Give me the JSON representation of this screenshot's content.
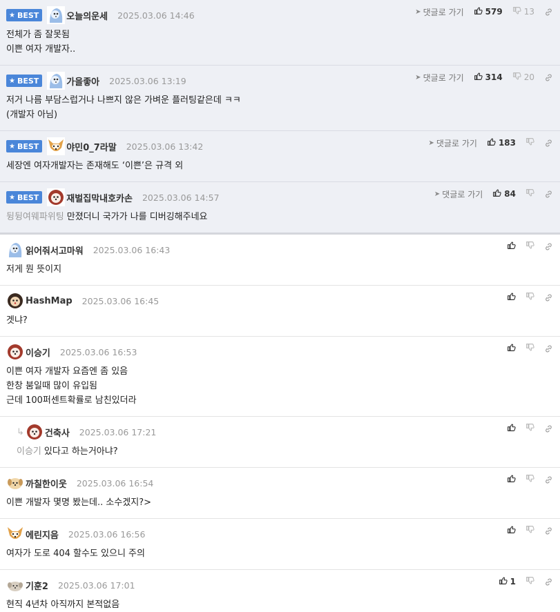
{
  "labels": {
    "best": "BEST",
    "reply_link": "댓글로 가기"
  },
  "colors": {
    "best_badge": "#4a86d9",
    "best_bg": "#eef0f5"
  },
  "comments": [
    {
      "best": true,
      "avatar": "blue",
      "nick": "오늘의운세",
      "time": "2025.03.06 14:46",
      "mention": "",
      "lines": [
        "전체가 좀 잘못됨",
        "이쁜 여자 개발자.."
      ],
      "likes": "579",
      "dislikes": "13"
    },
    {
      "best": true,
      "avatar": "blue",
      "nick": "가을좋아",
      "time": "2025.03.06 13:19",
      "mention": "",
      "lines": [
        "저거 나름 부담스럽거나 나쁘지 않은 가벼운 플러팅같은데 ㅋㅋ",
        "(개발자 아님)"
      ],
      "likes": "314",
      "dislikes": "20"
    },
    {
      "best": true,
      "avatar": "fox",
      "nick": "야민0_7라말",
      "time": "2025.03.06 13:42",
      "mention": "",
      "lines": [
        "세장엔 여자개발자는 존재해도 ‘이쁜’은 규격 외"
      ],
      "likes": "183",
      "dislikes": ""
    },
    {
      "best": true,
      "avatar": "dog-red",
      "nick": "재벌집막내호카손",
      "time": "2025.03.06 14:57",
      "mention": "뒹뒹여웨파위팅",
      "lines": [
        "만졌더니 국가가 나를 디버깅해주네요"
      ],
      "likes": "84",
      "dislikes": ""
    },
    {
      "best": false,
      "avatar": "blue",
      "nick": "읽어줘서고마워",
      "time": "2025.03.06 16:43",
      "mention": "",
      "lines": [
        "저게 뭔 뜻이지"
      ],
      "likes": "",
      "dislikes": ""
    },
    {
      "best": false,
      "avatar": "dog-black",
      "nick": "HashMap",
      "time": "2025.03.06 16:45",
      "mention": "",
      "lines": [
        "겟냐?"
      ],
      "likes": "",
      "dislikes": ""
    },
    {
      "best": false,
      "avatar": "dog-red",
      "nick": "이승기",
      "time": "2025.03.06 16:53",
      "mention": "",
      "lines": [
        "이쁜 여자 개발자 요즘엔 좀 있음",
        "한창 붐일때 많이 유입됨",
        "근데 100퍼센트확률로 남친있더라"
      ],
      "likes": "",
      "dislikes": ""
    },
    {
      "best": false,
      "child": true,
      "avatar": "dog-red",
      "nick": "건축사",
      "time": "2025.03.06 17:21",
      "mention": "이승기",
      "lines": [
        "있다고 하는거아냐?"
      ],
      "likes": "",
      "dislikes": ""
    },
    {
      "best": false,
      "avatar": "puppy",
      "nick": "까칠한이웃",
      "time": "2025.03.06 16:54",
      "mention": "",
      "lines": [
        "이쁜 개발자 몇명 봤는데.. 소수겠지?>"
      ],
      "likes": "",
      "dislikes": ""
    },
    {
      "best": false,
      "avatar": "fox",
      "nick": "에린지음",
      "time": "2025.03.06 16:56",
      "mention": "",
      "lines": [
        "여자가 도로 404 할수도 있으니 주의"
      ],
      "likes": "",
      "dislikes": ""
    },
    {
      "best": false,
      "avatar": "puppy-grey",
      "nick": "기훈2",
      "time": "2025.03.06 17:01",
      "mention": "",
      "lines": [
        "현직 4년차 아직까지 본적없음"
      ],
      "likes": "1",
      "dislikes": ""
    }
  ]
}
